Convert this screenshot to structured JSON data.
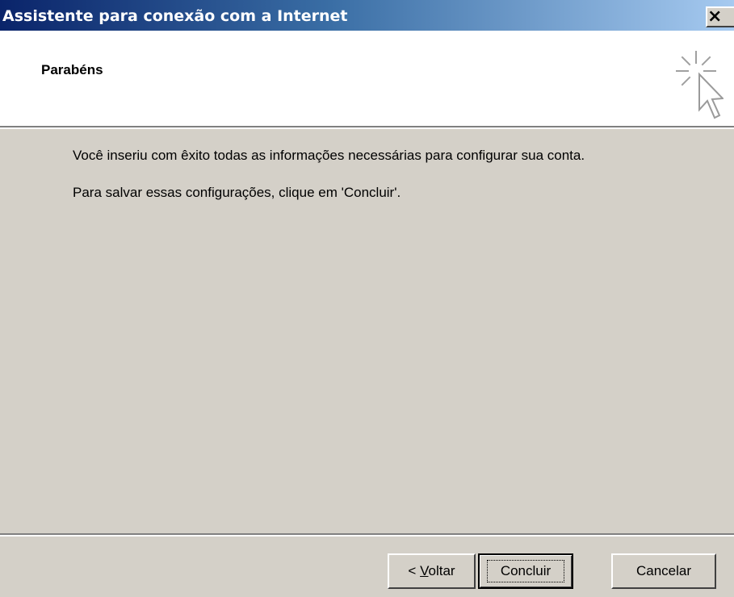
{
  "window": {
    "title": "Assistente para conexão com a Internet",
    "close_label": "×"
  },
  "header": {
    "title": "Parabéns",
    "icon": "cursor-click-icon"
  },
  "body": {
    "message_1": "Você inseriu com êxito todas as informações necessárias para configurar sua conta.",
    "message_2": "Para salvar essas configurações, clique em 'Concluir'."
  },
  "buttons": {
    "back_prefix": "< ",
    "back_mnemonic": "V",
    "back_rest": "oltar",
    "finish": "Concluir",
    "cancel": "Cancelar"
  },
  "colors": {
    "titlebar_start": "#0a246a",
    "titlebar_end": "#a6caf0",
    "face": "#d4d0c8",
    "header_bg": "#ffffff"
  }
}
